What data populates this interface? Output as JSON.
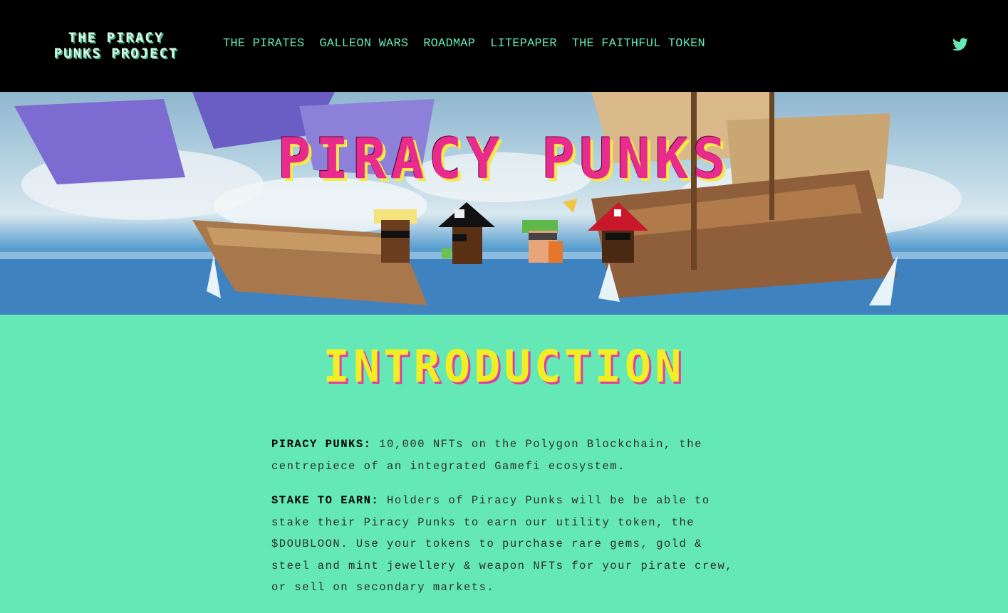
{
  "header": {
    "logo_line1": "THE PIRACY",
    "logo_line2": "PUNKS PROJECT",
    "nav": [
      {
        "label": "THE PIRATES"
      },
      {
        "label": "GALLEON WARS"
      },
      {
        "label": "ROADMAP"
      },
      {
        "label": "LITEPAPER"
      },
      {
        "label": "THE FAITHFUL TOKEN"
      }
    ],
    "social_icon": "twitter-icon"
  },
  "hero": {
    "title": "PIRACY PUNKS"
  },
  "intro": {
    "title": "INTRODUCTION",
    "paragraphs": [
      {
        "label": "PIRACY PUNKS:",
        "text": " 10,000 NFTs on the Polygon Blockchain, the centrepiece of an integrated Gamefi ecosystem."
      },
      {
        "label": "STAKE TO EARN:",
        "text": " Holders of Piracy Punks will be be able to stake their Piracy Punks to earn our utility token, the $DOUBLOON. Use your tokens to purchase rare gems, gold & steel and mint jewellery & weapon NFTs for your pirate crew, or sell on secondary markets."
      }
    ]
  },
  "colors": {
    "background": "#64e8b6",
    "header_bg": "#000000",
    "nav_text": "#64e8b6",
    "hero_title": "#ea2b8e",
    "intro_title": "#f2ee24"
  }
}
